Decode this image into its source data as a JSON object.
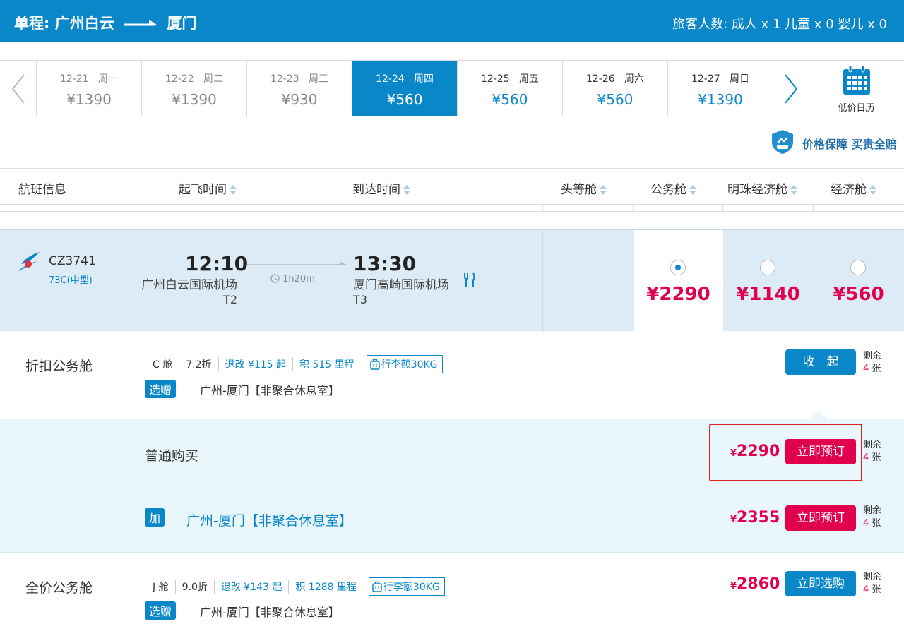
{
  "header": {
    "trip_type": "单程:",
    "from_city": "广州白云",
    "to_city": "厦门",
    "passengers": "旅客人数: 成人 x 1 儿童 x 0 婴儿 x 0"
  },
  "dates": [
    {
      "date": "12-21",
      "weekday": "周一",
      "price": "¥1390",
      "state": "past"
    },
    {
      "date": "12-22",
      "weekday": "周二",
      "price": "¥1390",
      "state": "past"
    },
    {
      "date": "12-23",
      "weekday": "周三",
      "price": "¥930",
      "state": "past"
    },
    {
      "date": "12-24",
      "weekday": "周四",
      "price": "¥560",
      "state": "active"
    },
    {
      "date": "12-25",
      "weekday": "周五",
      "price": "¥560",
      "state": "future"
    },
    {
      "date": "12-26",
      "weekday": "周六",
      "price": "¥560",
      "state": "future"
    },
    {
      "date": "12-27",
      "weekday": "周日",
      "price": "¥1390",
      "state": "future"
    }
  ],
  "calendar_label": "低价日历",
  "guarantee_text": "价格保障 买贵全赔",
  "columns": {
    "flight_info": "航班信息",
    "depart_time": "起飞时间",
    "arrive_time": "到达时间",
    "first": "头等舱",
    "business": "公务舱",
    "pearl_economy": "明珠经济舱",
    "economy": "经济舱"
  },
  "flight": {
    "number": "CZ3741",
    "aircraft": "73C(中型)",
    "depart_time": "12:10",
    "depart_airport": "广州白云国际机场",
    "depart_terminal": "T2",
    "duration": "1h20m",
    "arrive_time": "13:30",
    "arrive_airport": "厦门高崎国际机场",
    "arrive_terminal": "T3",
    "prices": {
      "business": "¥2290",
      "pearl_economy": "¥1140",
      "economy": "¥560"
    },
    "selected": "business"
  },
  "cabins": [
    {
      "title": "折扣公务舱",
      "class_code": "C 舱",
      "discount": "7.2折",
      "refund": "退改 ¥115 起",
      "mileage": "积 515 里程",
      "baggage": "行李额30KG",
      "gift_tag": "选赠",
      "gift_text": "广州-厦门【非聚合休息室】",
      "button": "收　起",
      "remain_label": "剩余",
      "remain_count": "4",
      "remain_unit": "张"
    },
    {
      "title": "全价公务舱",
      "class_code": "J 舱",
      "discount": "9.0折",
      "refund": "退改 ¥143 起",
      "mileage": "积 1288 里程",
      "baggage": "行李额30KG",
      "gift_tag": "选赠",
      "gift_text": "广州-厦门【非聚合休息室】",
      "price_symbol": "¥",
      "price": "2860",
      "button": "立即选购",
      "remain_label": "剩余",
      "remain_count": "4",
      "remain_unit": "张"
    }
  ],
  "options": [
    {
      "label": "普通购买",
      "price_symbol": "¥",
      "price": "2290",
      "button": "立即预订",
      "remain_label": "剩余",
      "remain_count": "4",
      "remain_unit": "张"
    },
    {
      "tag": "加",
      "label": "广州-厦门【非聚合休息室】",
      "price_symbol": "¥",
      "price": "2355",
      "button": "立即预订",
      "remain_label": "剩余",
      "remain_count": "4",
      "remain_unit": "张"
    }
  ],
  "colors": {
    "brand_blue": "#0a87c8",
    "price_red": "#e0004d",
    "highlight_red": "#e02020"
  }
}
